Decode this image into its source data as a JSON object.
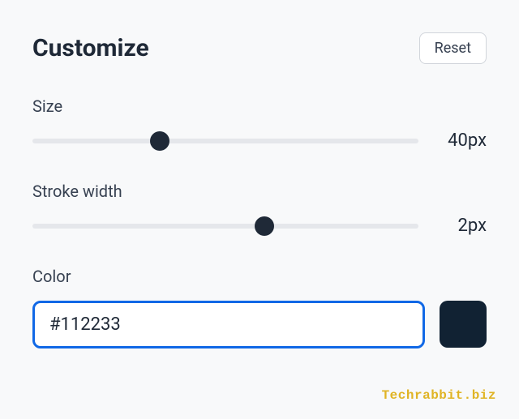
{
  "header": {
    "title": "Customize",
    "reset_label": "Reset"
  },
  "controls": {
    "size": {
      "label": "Size",
      "value_display": "40px",
      "thumb_percent": 33
    },
    "stroke": {
      "label": "Stroke width",
      "value_display": "2px",
      "thumb_percent": 60
    },
    "color": {
      "label": "Color",
      "value": "#112233",
      "swatch_hex": "#112233"
    }
  },
  "watermark": "Techrabbit.biz"
}
